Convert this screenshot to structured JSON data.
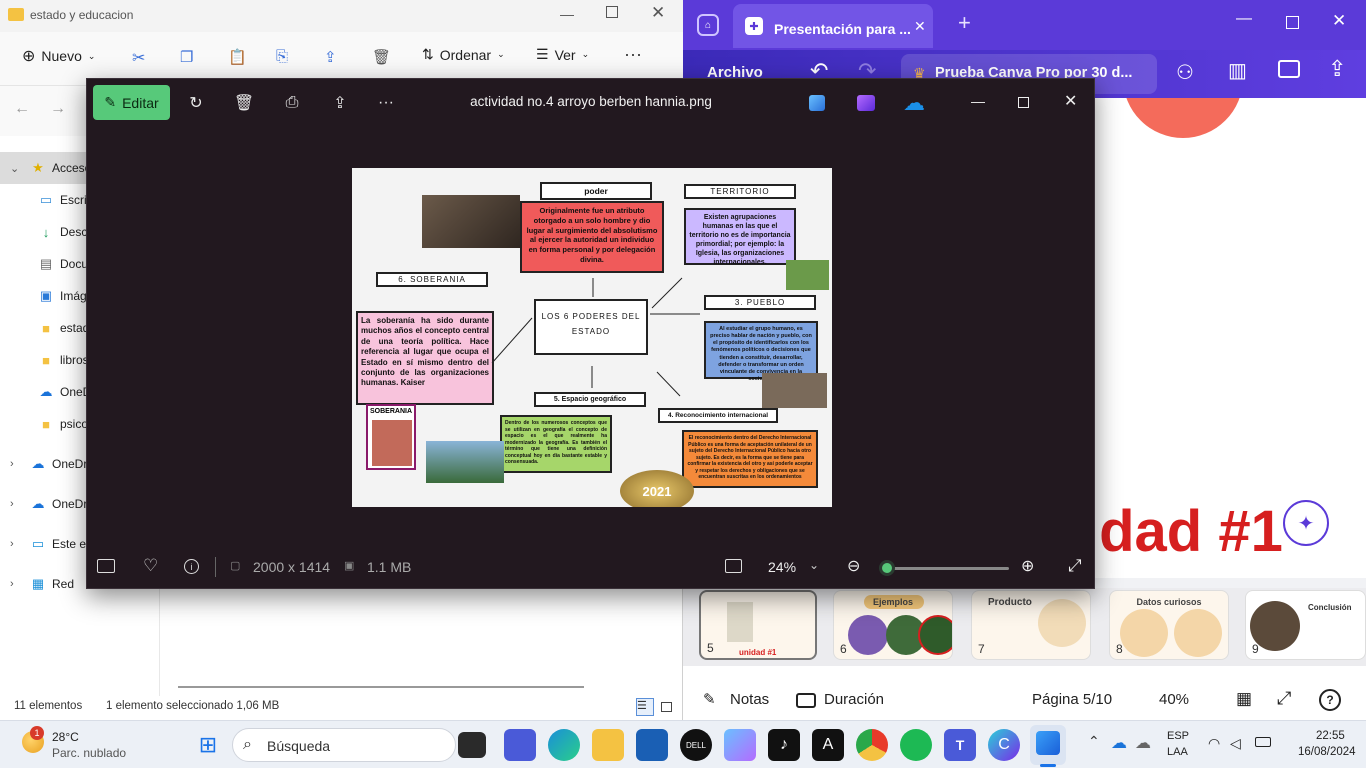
{
  "explorer": {
    "title": "estado y educacion",
    "new_label": "Nuevo",
    "sort_label": "Ordenar",
    "view_label": "Ver",
    "sidebar": [
      {
        "label": "Accesos",
        "icon": "star-icon"
      },
      {
        "label": "Escritorio",
        "icon": "desktop-icon"
      },
      {
        "label": "Descargas",
        "icon": "download-icon"
      },
      {
        "label": "Documentos",
        "icon": "document-icon"
      },
      {
        "label": "Imágenes",
        "icon": "image-icon"
      },
      {
        "label": "estado",
        "icon": "folder-icon"
      },
      {
        "label": "libros",
        "icon": "folder-icon"
      },
      {
        "label": "OneDrive",
        "icon": "cloud-icon"
      },
      {
        "label": "psicología",
        "icon": "folder-icon"
      },
      {
        "label": "OneDrive",
        "icon": "cloud-icon"
      },
      {
        "label": "OneDrive",
        "icon": "cloud-icon"
      },
      {
        "label": "Este equipo",
        "icon": "computer-icon"
      },
      {
        "label": "Red",
        "icon": "network-icon"
      }
    ],
    "status_count": "11 elementos",
    "status_selected": "1 elemento seleccionado  1,06 MB"
  },
  "canva": {
    "tab_label": "Presentación para ...",
    "archivo": "Archivo",
    "promo": "Prueba Canva Pro por 30 d...",
    "slide_title": "idad #1",
    "thumbs": [
      {
        "n": "5",
        "title": "unidad #1"
      },
      {
        "n": "6",
        "title": "Ejemplos"
      },
      {
        "n": "7",
        "title": "Producto"
      },
      {
        "n": "8",
        "title": "Datos curiosos"
      },
      {
        "n": "9",
        "title": "Conclusión"
      }
    ],
    "notes": "Notas",
    "duration": "Duración",
    "page": "Página 5/10",
    "zoom": "40%"
  },
  "photos": {
    "edit_label": "Editar",
    "filename": "actividad no.4 arroyo berben hannia.png",
    "dimensions": "2000 x 1414",
    "size": "1.1 MB",
    "zoom": "24%",
    "zoom_level": 0.05
  },
  "mindmap": {
    "center": "LOS 6 PODERES DEL ESTADO",
    "poder": "poder",
    "poder_text": "Originalmente fue un atributo otorgado a un solo hombre y dio lugar al surgimiento del absolutismo al ejercer la autoridad un individuo en forma personal y por delegación divina.",
    "territorio": "TERRITORIO",
    "territorio_text": "Existen agrupaciones humanas en las que el territorio no es de importancia primordial; por ejemplo: la Iglesia, las organizaciones internacionales.",
    "soberania": "6. SOBERANIA",
    "soberania_text": "La soberanía ha sido durante muchos años el concepto central de una teoría política. Hace referencia al lugar que ocupa el Estado en sí mismo dentro del conjunto de las organizaciones humanas. Kaiser",
    "soberania_img": "SOBERANIA",
    "pueblo": "3. PUEBLO",
    "pueblo_text": "Al estudiar el grupo humano, es preciso hablar de nación y pueblo, con el propósito de identificarlos con los fenómenos políticos o decisiones que tienden a constituir, desarrollar, defender o transformar un orden vinculante de convivencia en la sociedad.",
    "espacio": "5. Espacio geográfico",
    "espacio_text": "Dentro de los numerosos conceptos que se utilizan en geografía el concepto de espacio es el que realmente ha modernizado la geografía. Es también el término que tiene una definición conceptual hoy en día bastante estable y consensuada.",
    "reconocimiento": "4. Reconocimiento internacional",
    "reconocimiento_text": "El reconocimiento dentro del Derecho Internacional Público es una forma de aceptación unilateral de un sujeto del Derecho Internacional Público hacia otro sujeto. Es decir, es la forma que se tiene para confirmar la existencia del otro y así poderle aceptar y respetar los derechos y obligaciones que se encuentran suscritas en los ordenamientos",
    "coin": "2021"
  },
  "taskbar": {
    "temp": "28°C",
    "weather": "Parc. nublado",
    "search": "Búsqueda",
    "lang1": "ESP",
    "lang2": "LAA",
    "time": "22:55",
    "date": "16/08/2024",
    "badge": "1"
  },
  "colors": {
    "accent_green": "#57c97a",
    "canva_purple": "#5b3ad8",
    "red_text": "#d61f1f"
  }
}
